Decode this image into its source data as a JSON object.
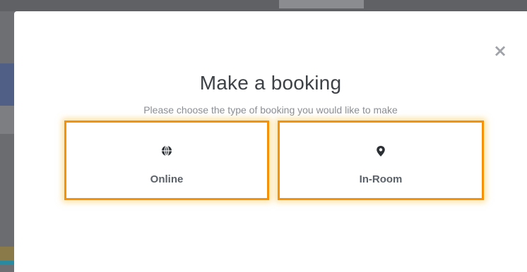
{
  "modal": {
    "title": "Make a booking",
    "subtitle": "Please choose the type of booking you would like to make",
    "close_symbol": "×",
    "options": [
      {
        "label": "Online",
        "icon": "globe-icon"
      },
      {
        "label": "In-Room",
        "icon": "map-marker-icon"
      }
    ]
  },
  "colors": {
    "accent_border": "#f5920a",
    "title_text": "#3d4246",
    "subtitle_text": "#8a8e93",
    "overlay": "#6d6f73"
  }
}
